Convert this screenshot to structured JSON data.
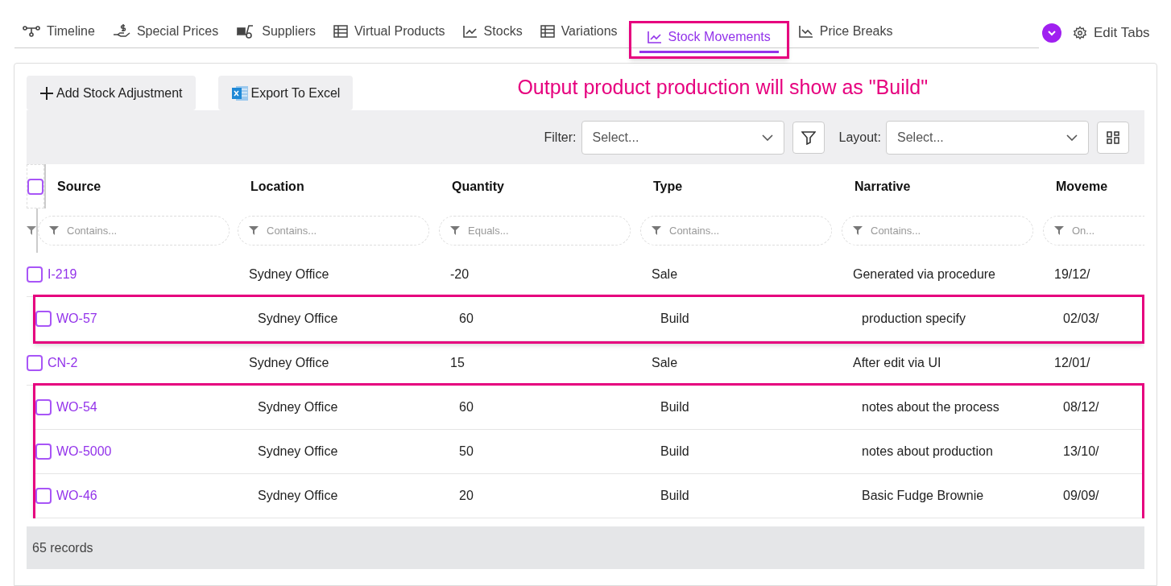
{
  "tabs": [
    {
      "label": "Timeline",
      "kind": "timeline",
      "selected": false,
      "annotated": false
    },
    {
      "label": "Special Prices",
      "kind": "price",
      "selected": false,
      "annotated": false
    },
    {
      "label": "Suppliers",
      "kind": "truck",
      "selected": false,
      "annotated": false
    },
    {
      "label": "Virtual Products",
      "kind": "table",
      "selected": false,
      "annotated": false
    },
    {
      "label": "Stocks",
      "kind": "chart",
      "selected": false,
      "annotated": false
    },
    {
      "label": "Variations",
      "kind": "table",
      "selected": false,
      "annotated": false
    },
    {
      "label": "Stock Movements",
      "kind": "chart",
      "selected": true,
      "annotated": true
    },
    {
      "label": "Price Breaks",
      "kind": "chartdown",
      "selected": false,
      "annotated": false
    }
  ],
  "edit_tabs": "Edit Tabs",
  "buttons": [
    {
      "label": "Add Stock Adjustment",
      "kind": "plus"
    },
    {
      "label": "Export To Excel",
      "kind": "excel"
    }
  ],
  "annotation": "Output product production will show as \"Build\"",
  "toolbar": {
    "filter_label": "Filter:",
    "filter_placeholder": "Select...",
    "layout_label": "Layout:",
    "layout_placeholder": "Select..."
  },
  "table": {
    "select_all_checked": false,
    "columns": [
      {
        "label": "Source",
        "filter": "Contains..."
      },
      {
        "label": "Location",
        "filter": "Contains..."
      },
      {
        "label": "Quantity",
        "filter": "Equals..."
      },
      {
        "label": "Type",
        "filter": "Contains..."
      },
      {
        "label": "Narrative",
        "filter": "Contains..."
      },
      {
        "label": "Moveme",
        "filter": "On..."
      }
    ],
    "rows": [
      {
        "checked": false,
        "highlighted": false,
        "cells": [
          "I-219",
          "Sydney Office",
          "-20",
          "Sale",
          "Generated via procedure",
          "19/12/"
        ]
      },
      {
        "checked": false,
        "highlighted": true,
        "cells": [
          "WO-57",
          "Sydney Office",
          "60",
          "Build",
          "production specify",
          "02/03/"
        ]
      },
      {
        "checked": false,
        "highlighted": false,
        "cells": [
          "CN-2",
          "Sydney Office",
          "15",
          "Sale",
          "After edit via UI",
          "12/01/"
        ]
      },
      {
        "checked": false,
        "highlighted": true,
        "cells": [
          "WO-54",
          "Sydney Office",
          "60",
          "Build",
          "notes about the process",
          "08/12/"
        ]
      },
      {
        "checked": false,
        "highlighted": true,
        "cells": [
          "WO-5000",
          "Sydney Office",
          "50",
          "Build",
          "notes about production",
          "13/10/"
        ]
      },
      {
        "checked": false,
        "highlighted": true,
        "cells": [
          "WO-46",
          "Sydney Office",
          "20",
          "Build",
          "Basic Fudge Brownie",
          "09/09/"
        ]
      }
    ]
  },
  "status_bar": "65 records"
}
